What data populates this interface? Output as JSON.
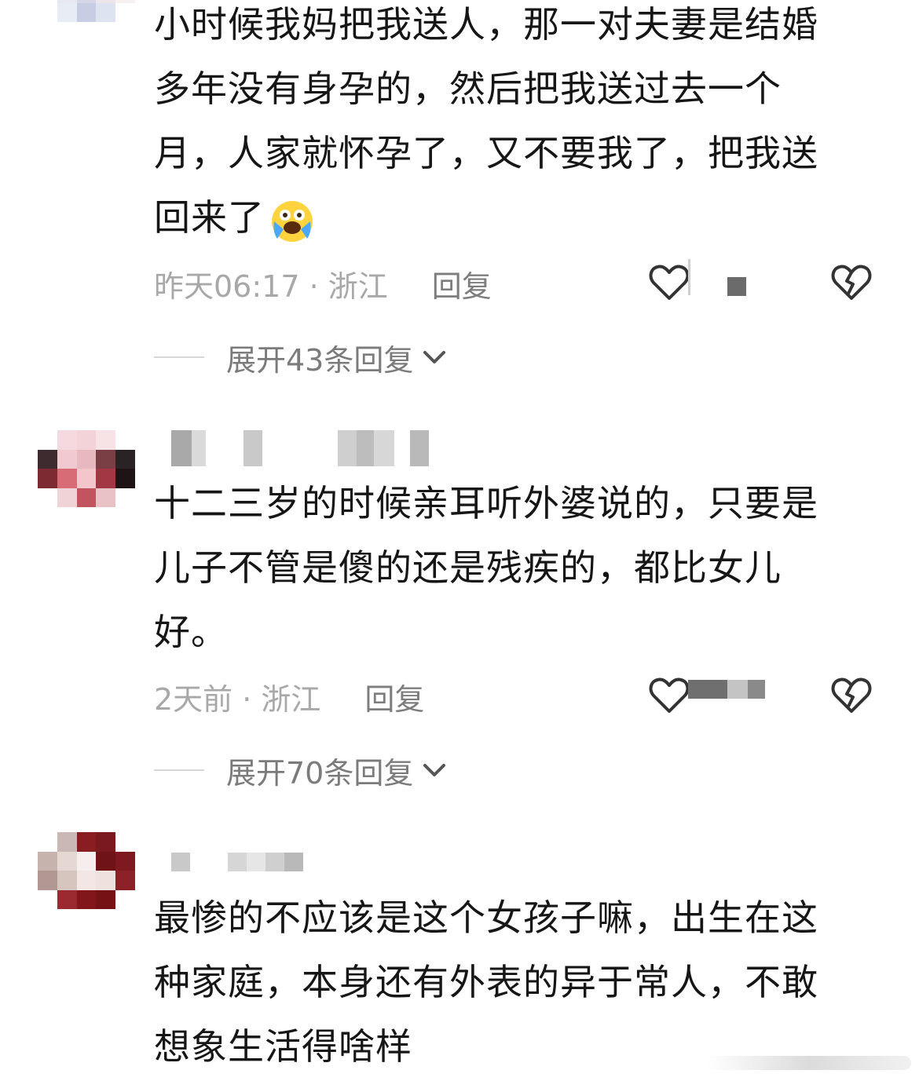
{
  "comments": [
    {
      "text": "小时候我妈把我送人，那一对夫妻是结婚多年没有身孕的，然后把我送过去一个月，人家就怀孕了，又不要我了，把我送回来了",
      "emoji": "crying-face-emoji",
      "time": "昨天06:17 · 浙江",
      "reply_label": "回复",
      "expand_label": "展开43条回复"
    },
    {
      "text": "十二三岁的时候亲耳听外婆说的，只要是儿子不管是傻的还是残疾的，都比女儿好。",
      "time": "2天前 · 浙江",
      "reply_label": "回复",
      "expand_label": "展开70条回复"
    },
    {
      "text": "最惨的不应该是这个女孩子嘛，出生在这种家庭，本身还有外表的异于常人，不敢想象生活得啥样"
    }
  ],
  "colors": {
    "text": "#161616",
    "meta": "#a8a8a8",
    "reply": "#7d7d7d",
    "icon": "#333333"
  }
}
